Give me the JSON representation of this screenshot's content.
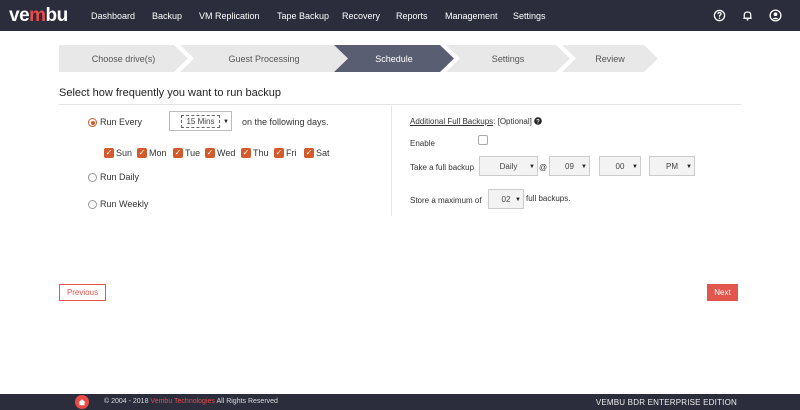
{
  "brand": {
    "logo_left": "ve",
    "logo_accent": "m",
    "logo_right": "bu"
  },
  "nav": {
    "items": [
      "Dashboard",
      "Backup",
      "VM Replication",
      "Tape Backup",
      "Recovery",
      "Reports",
      "Management",
      "Settings"
    ],
    "icons": [
      "help-icon",
      "bell-icon",
      "user-icon"
    ]
  },
  "wizard": {
    "steps": [
      "Choose drive(s)",
      "Guest Processing",
      "Schedule",
      "Settings",
      "Review"
    ],
    "active_index": 2
  },
  "schedule": {
    "title": "Select how frequently you want to run backup",
    "run_every_label": "Run Every",
    "interval_value": "15 Mins",
    "following_days_label": "on the following days.",
    "days": [
      "Sun",
      "Mon",
      "Tue",
      "Wed",
      "Thu",
      "Fri",
      "Sat"
    ],
    "run_daily_label": "Run Daily",
    "run_weekly_label": "Run Weekly"
  },
  "full_backups": {
    "title": "Additional Full Backups",
    "optional": ": [Optional]",
    "enable_label": "Enable",
    "take_label": "Take a full backup",
    "frequency": "Daily",
    "at": "@",
    "hour": "09",
    "minute": "00",
    "ampm": "PM",
    "store_label": "Store a maximum of",
    "max_count": "02",
    "store_suffix": "full backups."
  },
  "buttons": {
    "previous": "Previous",
    "next": "Next"
  },
  "footer": {
    "copyright": "© 2004 - 2018",
    "company": "Vembu Technologies",
    "rights": "All Rights Reserved",
    "edition": "VEMBU BDR ENTERPRISE EDITION"
  },
  "colors": {
    "nav_bg": "#2b2d3d",
    "accent": "#e94b47",
    "check": "#d35b2b",
    "active_step": "#5a5e73"
  }
}
